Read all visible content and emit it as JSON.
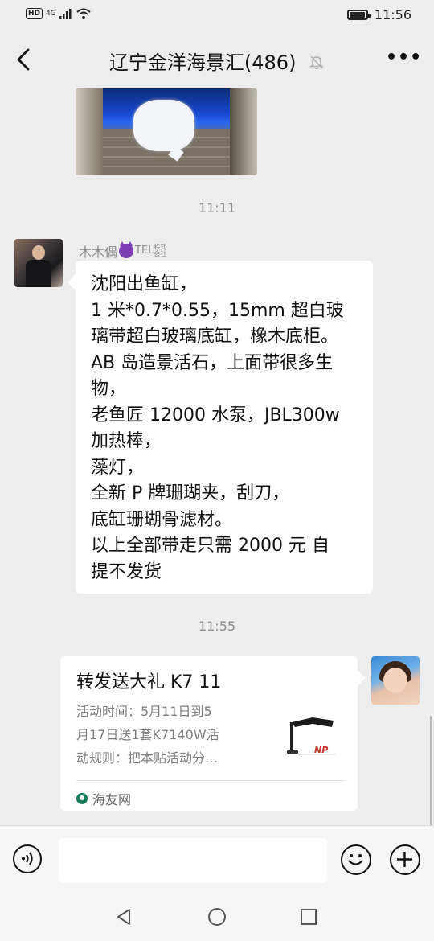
{
  "status_bar": {
    "network": "4G",
    "hd": "HD",
    "time": "11:56",
    "battery_level": 0.85
  },
  "header": {
    "title": "辽宁金洋海景汇(486)",
    "icons": [
      "back-arrow-icon",
      "mute-bell-icon",
      "more-icon"
    ]
  },
  "messages": [
    {
      "type": "image",
      "direction": "incoming"
    },
    {
      "type": "timestamp",
      "text": "11:11"
    },
    {
      "type": "text",
      "direction": "incoming",
      "sender": "木木偶",
      "sender_badge": "TEL",
      "sender_badge_small": "株式会社",
      "lines": [
        "沈阳出鱼缸，",
        "1 米*0.7*0.55，15mm 超白玻",
        "璃带超白玻璃底缸，橡木底柜。",
        "AB 岛造景活石，上面带很多生",
        "物，",
        "老鱼匠 12000 水泵，JBL300w",
        "加热棒，",
        "藻灯，",
        "全新 P 牌珊瑚夹，刮刀，",
        "底缸珊瑚骨滤材。",
        "以上全部带走只需 2000 元 自",
        "提不发货"
      ]
    },
    {
      "type": "timestamp",
      "text": "11:55"
    },
    {
      "type": "link_card",
      "direction": "outgoing",
      "title": "转发送大礼 K7 11",
      "desc_lines": [
        "活动时间：5月11日到5",
        "月17日送1套K7140W活",
        "动规则：把本贴活动分…"
      ],
      "source": "海友网",
      "thumb_text": "NP"
    }
  ],
  "input_bar": {
    "placeholder": "",
    "icons": [
      "voice-icon",
      "emoji-icon",
      "plus-icon"
    ]
  },
  "nav_bar": {
    "icons": [
      "back-triangle-icon",
      "home-circle-icon",
      "recent-square-icon"
    ]
  }
}
